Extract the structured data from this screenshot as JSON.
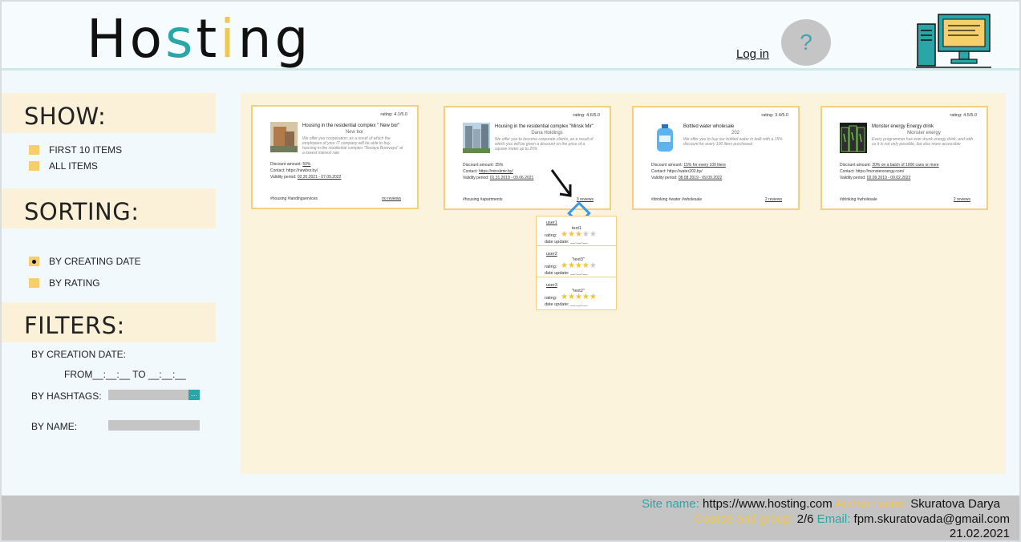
{
  "header": {
    "logo_part1": "Ho",
    "logo_part2": "s",
    "logo_part3": "t",
    "logo_part4": "i",
    "logo_part5": "ng",
    "login": "Log in",
    "help": "?"
  },
  "sidebar": {
    "show_title": "SHOW:",
    "show_options": [
      "FIRST 10 ITEMS",
      "ALL ITEMS"
    ],
    "sorting_title": "SORTING:",
    "sorting_options": [
      "BY CREATING DATE",
      "BY RATING"
    ],
    "filters_title": "FILTERS:",
    "by_creation_date": "BY CREATION DATE:",
    "date_range": "FROM__:__:__ TO __:__:__",
    "by_hashtags": "BY HASHTAGS:",
    "hashtag_button": "...",
    "by_name": "BY NAME:"
  },
  "cards": [
    {
      "rating": "rating: 4.1/5.0",
      "title": "Housing in the residential complex \" New bor\"",
      "company": "New bor",
      "description": "We offer you cooperation: as a result of which the employees of your IT company will be able to buy housing in the residential complex \"Novaya Borovaya\" at a lowest interest rate",
      "discount_label": "Discount amount: ",
      "discount": "50%",
      "contact_label": "Contact: ",
      "contact": "https://newbor.by/",
      "validity_label": "Validity period: ",
      "validity": "02.20.2021 - 07.09.2022",
      "tags": "#housing #landingservices",
      "reviews": "no reviews"
    },
    {
      "rating": "rating: 4.6/5.0",
      "title": "Housing in the residential complex \"Minsk Mir\"",
      "company": "Dana Holdings",
      "description": "We offer you to become corporate clients, as a result of which you will be given a discount on the price of a square meter up to 25%",
      "discount_label": "Discount amount: ",
      "discount": "25%",
      "contact_label": "Contact: ",
      "contact": "https://minskmir.by/",
      "validity_label": "Validity period: ",
      "validity": "01.31.2019 - 09.06.2021",
      "tags": "#housing #apartments",
      "reviews": "3 reviews"
    },
    {
      "rating": "rating: 3.4/5.0",
      "title": "Bottled water wholesale",
      "company": "202",
      "description": "We offer you to buy our bottled water in bulk with a 15% discount for every 100 liters purchased",
      "discount_label": "Discount amount: ",
      "discount": "15% for every 100 liters",
      "contact_label": "Contact: ",
      "contact": "https://water202.by/",
      "validity_label": "Validity period: ",
      "validity": "08.08.2019 - 09.09.2022",
      "tags": "#drinking #water #wholesale",
      "reviews": "2 reviews"
    },
    {
      "rating": "rating: 4.5/5.0",
      "title": "Monster energy Energy drink",
      "company": "Monster energy",
      "description": "Every programmer has ever drunk energy drink, and with us it is not only possible, but also more accessible",
      "discount_label": "Discount amount: ",
      "discount": "20% on a batch of 1000 cans or more",
      "contact_label": "Contact: ",
      "contact": "https://monsterenergy.com/",
      "validity_label": "Validity period: ",
      "validity": "02.09.2019 - 09.02.2022",
      "tags": "#drinking #wholesale",
      "reviews": "2 reviews"
    }
  ],
  "reviews_panel": [
    {
      "user": "user1",
      "text": "text1",
      "rating_label": "rating:",
      "stars": 3,
      "date_label": "date update: __.__.__"
    },
    {
      "user": "user2",
      "text": "\"text3\"",
      "rating_label": "rating:",
      "stars": 4,
      "date_label": "date update: __.__.__"
    },
    {
      "user": "user3",
      "text": "\"text2\"",
      "rating_label": "rating:",
      "stars": 5,
      "date_label": "date update: __.__.__"
    }
  ],
  "footer": {
    "site_label": "Site name: ",
    "site": "https://www.hosting.com",
    "author_label": " Author name: ",
    "author": "Skuratova Darya",
    "course_label": "Course and group: ",
    "course": "2/6",
    "email_label": " Email: ",
    "email": "fpm.skuratovada@gmail.com",
    "date": "21.02.2021"
  },
  "colors": {
    "accent_teal": "#2ba6a8",
    "accent_yellow": "#f3c650",
    "panel_bg": "#fbf3dc",
    "card_border": "#f5d07a"
  }
}
